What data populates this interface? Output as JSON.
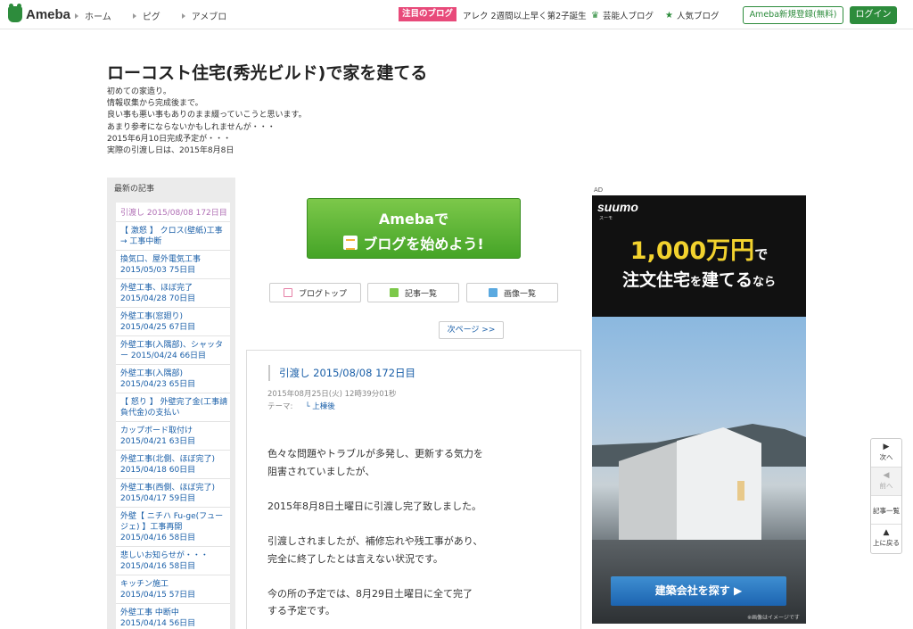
{
  "topbar": {
    "logo": "Ameba",
    "nav": [
      "ホーム",
      "ピグ",
      "アメブロ"
    ],
    "attention_badge": "注目のブログ",
    "attention_text": "アレク 2週間以上早く第2子誕生",
    "link_celebrity": "芸能人ブログ",
    "link_popular": "人気ブログ",
    "register": "Ameba新規登録(無料)",
    "login": "ログイン",
    "accent_color": "#2d8c3c"
  },
  "blog": {
    "title": "ローコスト住宅(秀光ビルド)で家を建てる",
    "description": [
      "初めての家造り。",
      "情報収集から完成後まで。",
      "良い事も悪い事もありのまま綴っていこうと思います。",
      "あまり参考にならないかもしれませんが・・・",
      "2015年6月10日完成予定が・・・",
      "実際の引渡し日は、2015年8月8日"
    ]
  },
  "sidebar": {
    "heading": "最新の記事",
    "items": [
      {
        "title": "引渡し 2015/08/08 172日目",
        "date": "",
        "current": true
      },
      {
        "title": "【 激怒 】 クロス(壁紙)工事 → 工事中断",
        "date": ""
      },
      {
        "title": "換気口、屋外電気工事",
        "date": "2015/05/03 75日目"
      },
      {
        "title": "外壁工事、ほぼ完了",
        "date": "2015/04/28 70日目"
      },
      {
        "title": "外壁工事(窓廻り)",
        "date": "2015/04/25 67日目"
      },
      {
        "title": "外壁工事(入隅部)、シャッター 2015/04/24 66日目",
        "date": ""
      },
      {
        "title": "外壁工事(入隅部)",
        "date": "2015/04/23 65日目"
      },
      {
        "title": "【 怒り 】 外壁完了金(工事請負代金)の支払い",
        "date": ""
      },
      {
        "title": "カップボード取付け",
        "date": "2015/04/21 63日目"
      },
      {
        "title": "外壁工事(北側、ほぼ完了) 2015/04/18 60日目",
        "date": ""
      },
      {
        "title": "外壁工事(西側、ほぼ完了) 2015/04/17 59日目",
        "date": ""
      },
      {
        "title": "外壁【 ニチハ Fu-ge(フュージェ) 】工事再開",
        "date": "2015/04/16 58日目"
      },
      {
        "title": "悲しいお知らせが・・・",
        "date": "2015/04/16 58日目"
      },
      {
        "title": "キッチン施工",
        "date": "2015/04/15 57日目"
      },
      {
        "title": "外壁工事 中断中",
        "date": "2015/04/14 56日目"
      }
    ]
  },
  "main": {
    "cta_line1": "Amebaで",
    "cta_line2": "ブログを始めよう!",
    "btn_blogtop": "ブログトップ",
    "btn_articles": "記事一覧",
    "btn_images": "画像一覧",
    "next_page": "次ページ >>",
    "article": {
      "title": "引渡し 2015/08/08 172日目",
      "datetime": "2015年08月25日(火) 12時39分01秒",
      "theme_label": "テーマ:",
      "theme": "└ 上棟後",
      "paragraphs": [
        [
          "色々な問題やトラブルが多発し、更新する気力を",
          "阻害されていましたが、"
        ],
        [
          "2015年8月8日土曜日に引渡し完了致しました。"
        ],
        [
          "引渡しされましたが、補修忘れや残工事があり、",
          "完全に終了したとは言えない状況です。"
        ],
        [
          "今の所の予定では、8月29日土曜日に全て完了",
          "する予定です。"
        ]
      ]
    }
  },
  "ad": {
    "label": "AD",
    "brand": "suumo",
    "brand_sub": "スーモ",
    "headline_big": "1,000万円",
    "headline_small": "で",
    "line2_a": "注文住宅",
    "line2_b": "を",
    "line2_c": "建てる",
    "line2_d": "なら",
    "cta": "建築会社を探す ▶",
    "note": "※画像はイメージです"
  },
  "float_nav": {
    "next": "次へ",
    "prev": "前へ",
    "list": "記事一覧",
    "top": "上に戻る"
  }
}
